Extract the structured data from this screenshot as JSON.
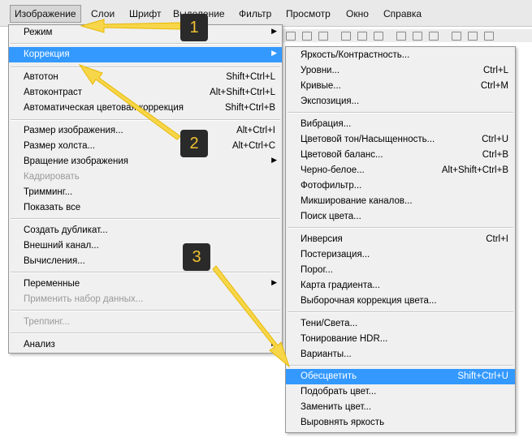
{
  "menubar": {
    "items": [
      {
        "label": "Изображение",
        "active": true
      },
      {
        "label": "Слои"
      },
      {
        "label": "Шрифт"
      },
      {
        "label": "Выделение"
      },
      {
        "label": "Фильтр"
      },
      {
        "label": "Просмотр"
      },
      {
        "label": "Окно"
      },
      {
        "label": "Справка"
      }
    ]
  },
  "image_menu": {
    "items": [
      {
        "label": "Режим",
        "submenu": true
      },
      {
        "label": "Коррекция",
        "submenu": true,
        "highlighted": true
      },
      {
        "label": "Автотон",
        "shortcut": "Shift+Ctrl+L"
      },
      {
        "label": "Автоконтраст",
        "shortcut": "Alt+Shift+Ctrl+L"
      },
      {
        "label": "Автоматическая цветовая коррекция",
        "shortcut": "Shift+Ctrl+B"
      },
      {
        "label": "Размер изображения...",
        "shortcut": "Alt+Ctrl+I"
      },
      {
        "label": "Размер холста...",
        "shortcut": "Alt+Ctrl+C"
      },
      {
        "label": "Вращение изображения",
        "submenu": true
      },
      {
        "label": "Кадрировать",
        "disabled": true
      },
      {
        "label": "Тримминг..."
      },
      {
        "label": "Показать все"
      },
      {
        "label": "Создать дубликат..."
      },
      {
        "label": "Внешний канал..."
      },
      {
        "label": "Вычисления..."
      },
      {
        "label": "Переменные",
        "submenu": true
      },
      {
        "label": "Применить набор данных...",
        "disabled": true
      },
      {
        "label": "Треппинг...",
        "disabled": true
      },
      {
        "label": "Анализ",
        "submenu": true
      }
    ]
  },
  "correction_menu": {
    "items": [
      {
        "label": "Яркость/Контрастность..."
      },
      {
        "label": "Уровни...",
        "shortcut": "Ctrl+L"
      },
      {
        "label": "Кривые...",
        "shortcut": "Ctrl+M"
      },
      {
        "label": "Экспозиция..."
      },
      {
        "label": "Вибрация..."
      },
      {
        "label": "Цветовой тон/Насыщенность...",
        "shortcut": "Ctrl+U"
      },
      {
        "label": "Цветовой баланс...",
        "shortcut": "Ctrl+B"
      },
      {
        "label": "Черно-белое...",
        "shortcut": "Alt+Shift+Ctrl+B"
      },
      {
        "label": "Фотофильтр..."
      },
      {
        "label": "Микширование каналов..."
      },
      {
        "label": "Поиск цвета..."
      },
      {
        "label": "Инверсия",
        "shortcut": "Ctrl+I"
      },
      {
        "label": "Постеризация..."
      },
      {
        "label": "Порог..."
      },
      {
        "label": "Карта градиента..."
      },
      {
        "label": "Выборочная коррекция цвета..."
      },
      {
        "label": "Тени/Света..."
      },
      {
        "label": "Тонирование HDR..."
      },
      {
        "label": "Варианты..."
      },
      {
        "label": "Обесцветить",
        "shortcut": "Shift+Ctrl+U",
        "highlighted": true
      },
      {
        "label": "Подобрать цвет..."
      },
      {
        "label": "Заменить цвет..."
      },
      {
        "label": "Выровнять яркость"
      }
    ]
  },
  "callouts": {
    "badges": [
      "1",
      "2",
      "3"
    ],
    "arrow_color": "#f7d64a",
    "badge_bg": "#2a2a2a",
    "badge_text_color": "#f1c232"
  },
  "colors": {
    "highlight": "#3399ff",
    "menu_bg": "#f0f0f0",
    "disabled_text": "#9a9a9a"
  }
}
